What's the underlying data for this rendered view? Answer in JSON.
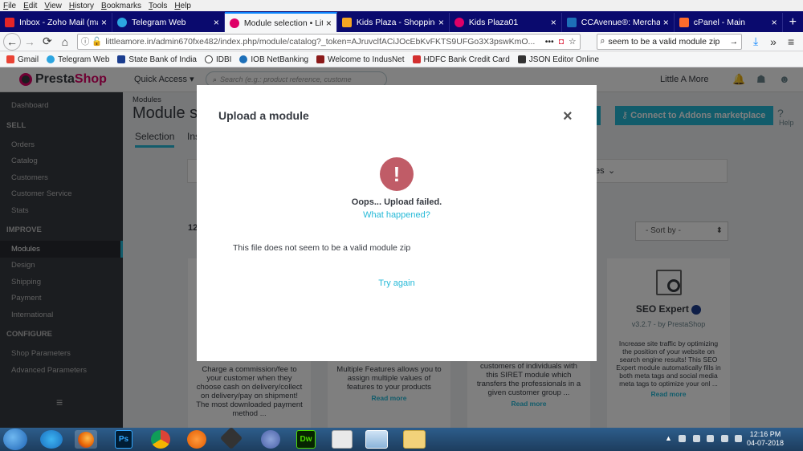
{
  "menubar": [
    "File",
    "Edit",
    "View",
    "History",
    "Bookmarks",
    "Tools",
    "Help"
  ],
  "tabs": [
    {
      "label": "Inbox - Zoho Mail (mam...",
      "color": "#e42527"
    },
    {
      "label": "Telegram Web",
      "color": "#2ca5e0"
    },
    {
      "label": "Module selection • Little...",
      "color": "#df0067"
    },
    {
      "label": "Kids Plaza - Shopping O...",
      "color": "#f5a623"
    },
    {
      "label": "Kids Plaza01",
      "color": "#df0067"
    },
    {
      "label": "CCAvenue®: Merchant...",
      "color": "#1d6fb8"
    },
    {
      "label": "cPanel - Main",
      "color": "#ff6c2c"
    }
  ],
  "active_tab_index": 2,
  "address": {
    "url": "littleamore.in/admin670fxe482/index.php/module/catalog?_token=AJruvclfACiJOcEbKvFKTS9UFGo3X3pswKmO...",
    "search": "seem to be a valid module zip"
  },
  "bookmarks": [
    {
      "label": "Gmail",
      "color": "#ea4335"
    },
    {
      "label": "Telegram Web",
      "color": "#2ca5e0"
    },
    {
      "label": "State Bank of India",
      "color": "#1a3d8f"
    },
    {
      "label": "IDBI",
      "color": "#333"
    },
    {
      "label": "IOB NetBanking",
      "color": "#1d6fb8"
    },
    {
      "label": "Welcome to IndusNet",
      "color": "#8b1a1a"
    },
    {
      "label": "HDFC Bank Credit Card",
      "color": "#d32f2f"
    },
    {
      "label": "JSON Editor Online",
      "color": "#333"
    }
  ],
  "header": {
    "logo_a": "Presta",
    "logo_b": "Shop",
    "quick_access": "Quick Access ▾",
    "search_placeholder": "Search (e.g.: product reference, custome",
    "shop_name": "Little A More",
    "help": "Help"
  },
  "sidebar": {
    "dashboard": "Dashboard",
    "sell": "SELL",
    "sell_items": [
      "Orders",
      "Catalog",
      "Customers",
      "Customer Service",
      "Stats"
    ],
    "improve": "IMPROVE",
    "improve_items": [
      "Modules",
      "Design",
      "Shipping",
      "Payment",
      "International"
    ],
    "configure": "CONFIGURE",
    "configure_items": [
      "Shop Parameters",
      "Advanced Parameters"
    ]
  },
  "page": {
    "breadcrumb": "Modules",
    "title": "Module s",
    "tab_selection": "Selection",
    "tab_ins": "Ins",
    "connect_button": "Connect to Addons marketplace",
    "upload_button_fragment": "e",
    "category_fragment": "es",
    "count_fragment": "12",
    "sort": "- Sort by -"
  },
  "cards": [
    {
      "desc": "Charge a commission/fee to your customer when they choose cash on delivery/collect on delivery/pay on shipment! The most downloaded payment method ...",
      "read_more": ""
    },
    {
      "desc": "Multiple Features allows you to assign multiple values of features to your products",
      "read_more": "Read more"
    },
    {
      "desc": "customers of individuals with this SIRET module which transfers the professionals in a given customer group ...",
      "read_more": "Read more"
    },
    {
      "title": "SEO Expert",
      "version": "v3.2.7 - by PrestaShop",
      "desc": "Increase site traffic by optimizing the position of your website on search engine results! This SEO Expert module automatically fills in both meta tags and social media meta tags to optimize your onl ...",
      "read_more": "Read more"
    }
  ],
  "modal": {
    "title": "Upload a module",
    "close": "×",
    "icon": "!",
    "oops": "Oops... Upload failed.",
    "what": "What happened?",
    "message": "This file does not seem to be a valid module zip",
    "try_again": "Try again"
  },
  "taskbar": {
    "time": "12:16 PM",
    "date": "04-07-2018"
  }
}
